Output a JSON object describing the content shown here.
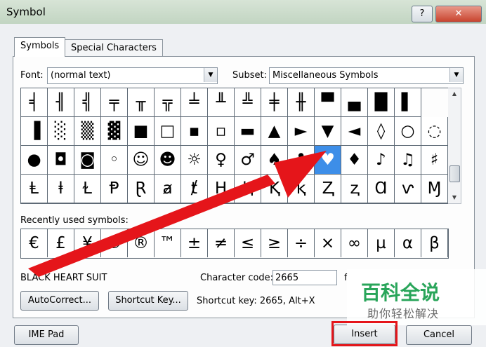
{
  "window": {
    "title": "Symbol",
    "help_label": "?",
    "close_label": "✕"
  },
  "tabs": [
    {
      "label": "Symbols",
      "active": true
    },
    {
      "label": "Special Characters",
      "active": false
    }
  ],
  "font": {
    "label": "Font:",
    "value": "(normal text)"
  },
  "subset": {
    "label": "Subset:",
    "value": "Miscellaneous Symbols"
  },
  "grid_rows": [
    [
      "╡",
      "╢",
      "╣",
      "╤",
      "╥",
      "╦",
      "╧",
      "╨",
      "╩",
      "╪",
      "╫",
      "▀",
      "▄",
      "█",
      "▌"
    ],
    [
      "▐",
      "░",
      "▒",
      "▓",
      "■",
      "□",
      "▪",
      "▫",
      "▬",
      "▲",
      "►",
      "▼",
      "◄",
      "◊",
      "○",
      "◌"
    ],
    [
      "●",
      "◘",
      "◙",
      "◦",
      "☺",
      "☻",
      "☼",
      "♀",
      "♂",
      "♠",
      "♣",
      "♥",
      "♦",
      "♪",
      "♫",
      "♯"
    ],
    [
      "Ⱡ",
      "ⱡ",
      "Ɫ",
      "Ᵽ",
      "Ɽ",
      "ⱥ",
      "ⱦ",
      "Ⱨ",
      "ⱨ",
      "Ⱪ",
      "ⱪ",
      "Ⱬ",
      "ⱬ",
      "Ɑ",
      "ⱱ",
      "Ɱ"
    ]
  ],
  "selected_symbol": {
    "row": 2,
    "col": 11
  },
  "recent": {
    "label": "Recently used symbols:",
    "symbols": [
      "€",
      "£",
      "¥",
      "©",
      "®",
      "™",
      "±",
      "≠",
      "≤",
      "≥",
      "÷",
      "×",
      "∞",
      "µ",
      "α",
      "β"
    ]
  },
  "char_name": "BLACK HEART SUIT",
  "char_code": {
    "label": "Character code:",
    "value": "2665",
    "from_prefix": "f"
  },
  "buttons": {
    "autocorrect": "AutoCorrect...",
    "shortcut_key": "Shortcut Key...",
    "ime_pad": "IME Pad",
    "insert": "Insert",
    "cancel": "Cancel"
  },
  "shortcut_text": "Shortcut key: 2665, Alt+X",
  "watermark": {
    "title": "百科全说",
    "subtitle": "助你轻松解决"
  },
  "colors": {
    "accent": "#3d8ee8",
    "annotation_red": "#e5151a",
    "watermark_green": "#29a55a"
  }
}
